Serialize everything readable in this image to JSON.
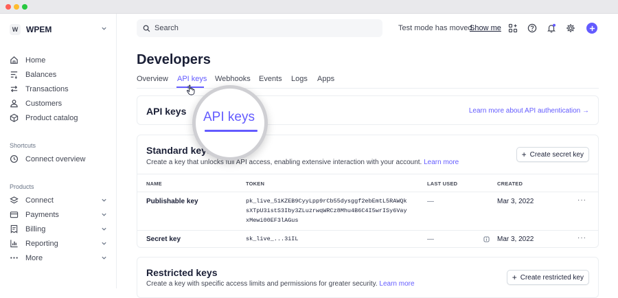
{
  "window": {
    "controls": [
      "close",
      "minimize",
      "maximize"
    ]
  },
  "account": {
    "logo_letter": "W",
    "name": "WPEM"
  },
  "sidebar": {
    "main_items": [
      {
        "label": "Home",
        "icon": "home-icon"
      },
      {
        "label": "Balances",
        "icon": "balances-icon"
      },
      {
        "label": "Transactions",
        "icon": "transactions-icon"
      },
      {
        "label": "Customers",
        "icon": "customers-icon"
      },
      {
        "label": "Product catalog",
        "icon": "product-catalog-icon"
      }
    ],
    "shortcuts_label": "Shortcuts",
    "shortcuts": [
      {
        "label": "Connect overview",
        "icon": "clock-icon"
      }
    ],
    "products_label": "Products",
    "products": [
      {
        "label": "Connect",
        "icon": "connect-icon"
      },
      {
        "label": "Payments",
        "icon": "payments-icon"
      },
      {
        "label": "Billing",
        "icon": "billing-icon"
      },
      {
        "label": "Reporting",
        "icon": "reporting-icon"
      },
      {
        "label": "More",
        "icon": "more-dots-icon"
      }
    ]
  },
  "topbar": {
    "search_placeholder": "Search",
    "test_mode_text": "Test mode has moved.",
    "show_me_label": "Show me"
  },
  "page": {
    "title": "Developers",
    "tabs": [
      "Overview",
      "API keys",
      "Webhooks",
      "Events",
      "Logs",
      "Apps"
    ],
    "active_tab": "API keys"
  },
  "api_keys_card": {
    "title": "API keys",
    "link": "Learn more about API authentication →"
  },
  "standard_keys": {
    "title": "Standard keys",
    "subtitle": "Create a key that unlocks full API access, enabling extensive interaction with your account.",
    "learn_more": "Learn more",
    "create_button": "Create secret key",
    "columns": [
      "NAME",
      "TOKEN",
      "LAST USED",
      "CREATED"
    ],
    "rows": [
      {
        "name": "Publishable key",
        "token_lines": [
          "pk_live_51KZEB9CyyLpp9rCb55dysggf2ebEmtL5RAWQk",
          "sXTpU3istS3Iby3ZLuzrwqWRCz8Mhu4B6C4I5wrISy6Vay",
          "xMewi00EF3lAGus"
        ],
        "last_used": "—",
        "created": "Mar 3, 2022"
      },
      {
        "name": "Secret key",
        "token": "sk_live_...3iIL",
        "last_used": "—",
        "created": "Mar 3, 2022"
      }
    ]
  },
  "restricted_keys": {
    "title": "Restricted keys",
    "subtitle": "Create a key with specific access limits and permissions for greater security.",
    "learn_more": "Learn more",
    "create_button": "Create restricted key"
  },
  "magnifier": {
    "text": "API keys"
  },
  "colors": {
    "accent": "#635bff",
    "text": "#1a1f36",
    "muted": "#414552",
    "border": "#ebeef1"
  }
}
